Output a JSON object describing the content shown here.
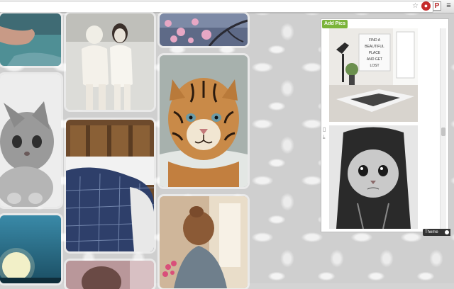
{
  "browser": {
    "star_icon": "star-icon",
    "extensions": [
      "adblock-extension-icon",
      "pinterest-extension-icon"
    ],
    "ext_p_label": "P",
    "menu_icon": "menu-icon"
  },
  "panel": {
    "add_button_label": "Add Pics",
    "poster_lines": [
      "FIND A",
      "BEAUTIFUL",
      "PLACE",
      "AND GET",
      "LOST"
    ],
    "theme_label": "Theme"
  },
  "pins": [
    {
      "name": "pin-hands-teal"
    },
    {
      "name": "pin-kitten-gray"
    },
    {
      "name": "pin-moon-sky"
    },
    {
      "name": "pin-vintage-women"
    },
    {
      "name": "pin-bed-plaid"
    },
    {
      "name": "pin-pink-portrait"
    },
    {
      "name": "pin-cherry-blossom"
    },
    {
      "name": "pin-tiger-cub"
    },
    {
      "name": "pin-girl-window"
    }
  ]
}
